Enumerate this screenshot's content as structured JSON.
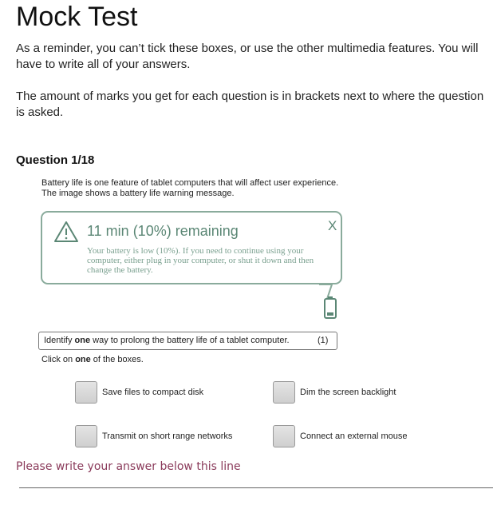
{
  "header": {
    "title": "Mock Test"
  },
  "intro": {
    "p1": "As a reminder, you can’t tick these boxes, or use the other multimedia features. You will have to write all of your answers.",
    "p2": "The amount of marks you get for each question is in brackets next to where the question is asked."
  },
  "question": {
    "heading": "Question 1/18",
    "text_line1": "Battery life is one feature of tablet computers that will affect user experience.",
    "text_line2": "The image shows a battery life warning message.",
    "alert": {
      "title": "11 min (10%) remaining",
      "close": "X",
      "body": "Your battery is low (10%). If you need to continue using your computer, either plug in your computer, or shut it down and then change the battery.",
      "icon": "warning-triangle-icon"
    },
    "prompt_pre": "Identify ",
    "prompt_bold": "one",
    "prompt_post": " way to prolong the battery life of a tablet computer.",
    "marks": "(1)",
    "instr_pre": "Click on ",
    "instr_bold": "one",
    "instr_post": " of the boxes.",
    "options": [
      {
        "label": "Save files to compact disk"
      },
      {
        "label": "Dim the screen backlight"
      },
      {
        "label": "Transmit on short range networks"
      },
      {
        "label": "Connect an external mouse"
      }
    ]
  },
  "answer": {
    "prompt": "Please write your answer below this line"
  },
  "colors": {
    "accent_green": "#5b8775",
    "prompt_color": "#8a3a5a"
  }
}
